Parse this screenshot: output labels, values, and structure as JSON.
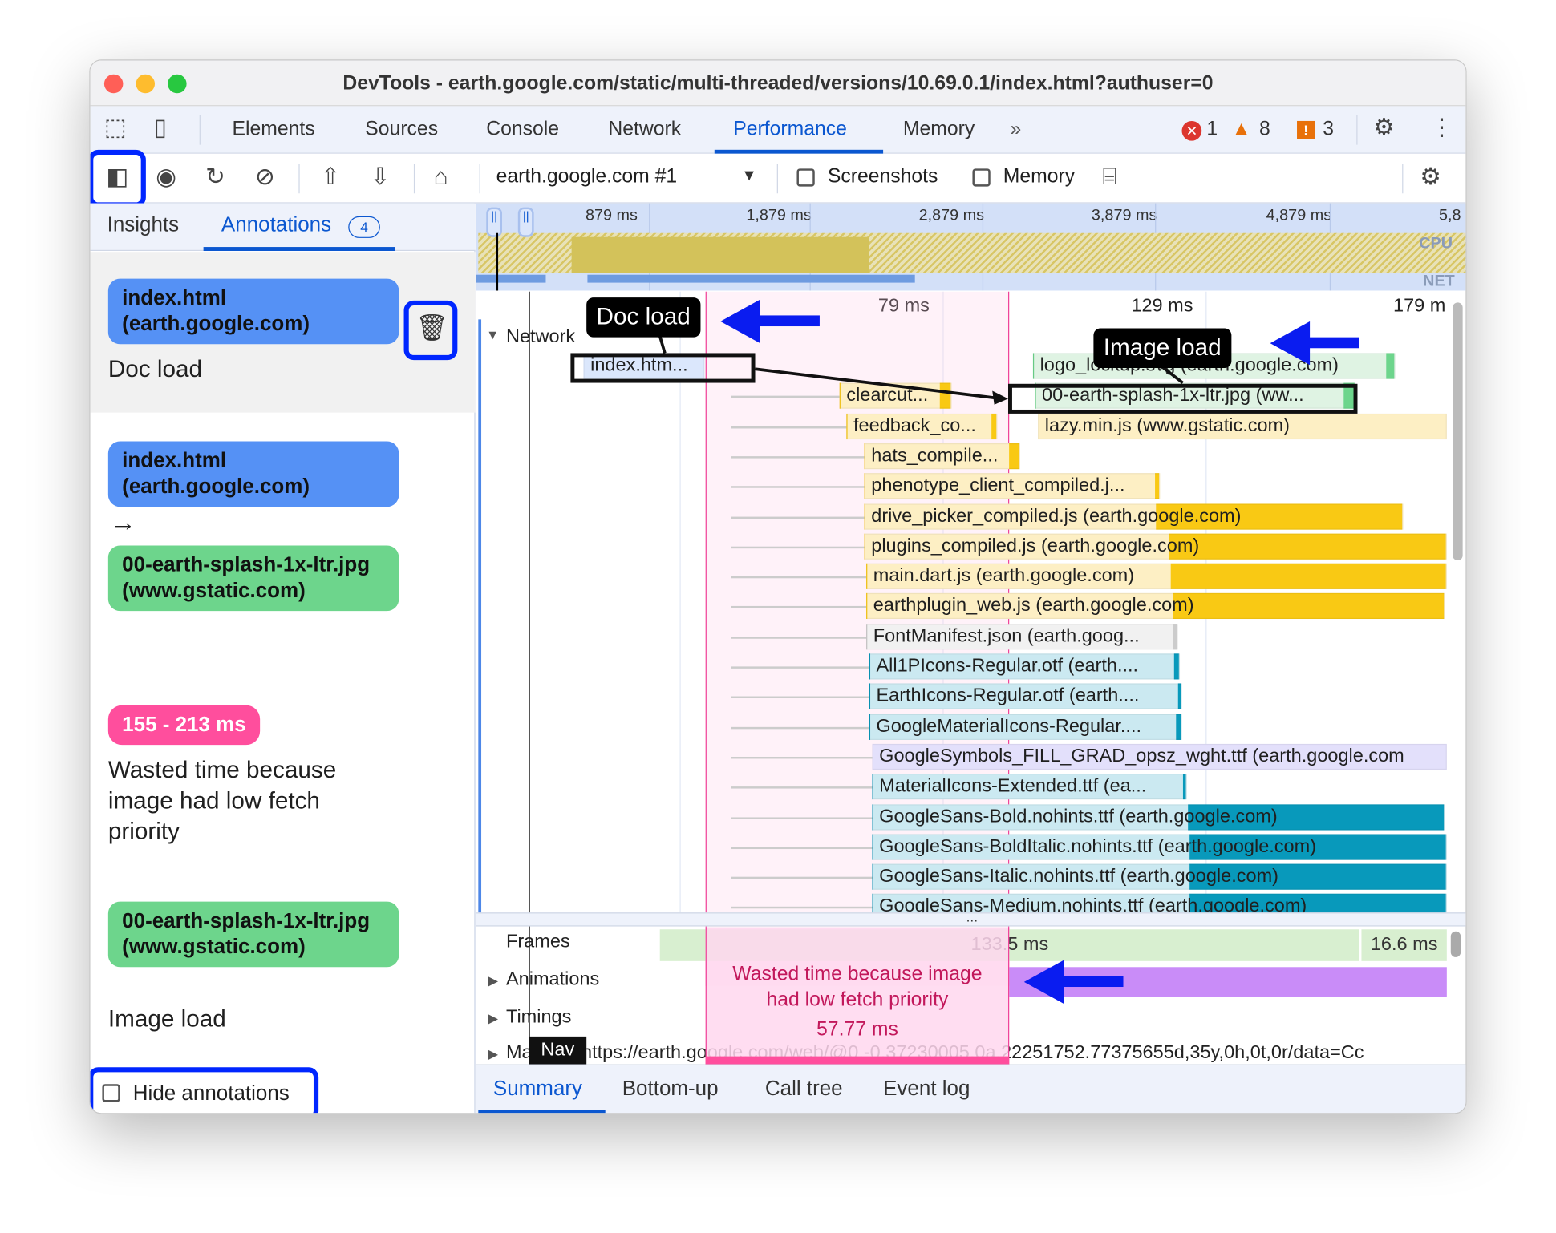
{
  "window": {
    "title": "DevTools - earth.google.com/static/multi-threaded/versions/10.69.0.1/index.html?authuser=0"
  },
  "tabs": [
    {
      "label": "Elements"
    },
    {
      "label": "Sources"
    },
    {
      "label": "Console"
    },
    {
      "label": "Network"
    },
    {
      "label": "Performance",
      "active": true
    },
    {
      "label": "Memory"
    }
  ],
  "status": {
    "errors": "1",
    "warnings": "8",
    "issues": "3"
  },
  "toolbar": {
    "recording_select": "earth.google.com #1",
    "screenshots_label": "Screenshots",
    "memory_label": "Memory",
    "screenshots_checked": false,
    "memory_checked": false
  },
  "sidebar": {
    "tabs": [
      {
        "label": "Insights"
      },
      {
        "label": "Annotations",
        "badge": "4",
        "active": true
      }
    ],
    "annotations": [
      {
        "chip": "index.html (earth.google.com)",
        "label": "Doc load"
      },
      {
        "from": "index.html (earth.google.com)",
        "arrow": "→",
        "to": "00-earth-splash-1x-ltr.jpg (www.gstatic.com)"
      },
      {
        "chip": "155 - 213 ms",
        "label": "Wasted time because image had low fetch priority"
      },
      {
        "chip": "00-earth-splash-1x-ltr.jpg (www.gstatic.com)",
        "label": "Image load"
      }
    ],
    "hide_annotations": "Hide annotations",
    "hide_checked": false
  },
  "overview": {
    "ticks": [
      "879 ms",
      "1,879 ms",
      "2,879 ms",
      "3,879 ms",
      "4,879 ms",
      "5,8"
    ],
    "cpu_label": "CPU",
    "net_label": "NET"
  },
  "timeline": {
    "ticks": [
      "79 ms",
      "129 ms",
      "179 m"
    ],
    "network_label": "Network",
    "doc_load_label": "Doc load",
    "image_load_label": "Image load",
    "requests": [
      "index.htm...",
      "logo_lockup.svg (earth.google.com)",
      "clearcut...",
      "00-earth-splash-1x-ltr.jpg (ww...",
      "feedback_co...",
      "lazy.min.js (www.gstatic.com)",
      "hats_compile...",
      "phenotype_client_compiled.j...",
      "drive_picker_compiled.js (earth.google.com)",
      "plugins_compiled.js (earth.google.com)",
      "main.dart.js (earth.google.com)",
      "earthplugin_web.js (earth.google.com)",
      "FontManifest.json (earth.goog...",
      "All1PIcons-Regular.otf (earth....",
      "EarthIcons-Regular.otf (earth....",
      "GoogleMaterialIcons-Regular....",
      "GoogleSymbols_FILL_GRAD_opsz_wght.ttf (earth.google.com",
      "MaterialIcons-Extended.ttf (ea...",
      "GoogleSans-Bold.nohints.ttf (earth.google.com)",
      "GoogleSans-BoldItalic.nohints.ttf (earth.google.com)",
      "GoogleSans-Italic.nohints.ttf (earth.google.com)",
      "GoogleSans-Medium.nohints.ttf (earth.google.com)"
    ],
    "more": "...",
    "frames_label": "Frames",
    "frame1": "133.5 ms",
    "frame2": "16.6 ms",
    "animations_label": "Animations",
    "timings_label": "Timings",
    "main_label": "Ma",
    "nav_label": "Nav",
    "main_url": "https://earth.google.com/web/@0,-0.37230005,0a,22251752.77375655d,35y,0h,0t,0r/data=Cc",
    "wasted_line1": "Wasted time because image",
    "wasted_line2": "had low fetch priority",
    "wasted_duration": "57.77 ms"
  },
  "bottom_tabs": [
    {
      "label": "Summary",
      "active": true
    },
    {
      "label": "Bottom-up"
    },
    {
      "label": "Call tree"
    },
    {
      "label": "Event log"
    }
  ],
  "colors": {
    "accent": "#0b57d0",
    "highlight": "#0026ff",
    "doc_chip": "#5591f5",
    "image_chip": "#6dd58c",
    "range_chip": "#ff4e9d",
    "wasted": "#c2185b"
  }
}
